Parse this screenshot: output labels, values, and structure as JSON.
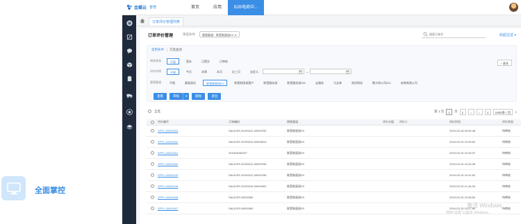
{
  "promo": {
    "label": "全面掌控",
    "icon": "monitor-icon"
  },
  "topbar": {
    "logo_text": "金蝶云",
    "logo_sub": "苍穹",
    "nav": [
      "首页",
      "应用",
      "B2B电商中..."
    ]
  },
  "tabs": {
    "active": "订单评价管理列表"
  },
  "panel": {
    "title": "订单评价管理",
    "filter_label": "筛选条件",
    "filter_chip": "管理渠道：联宽制画鼠EX ✕",
    "search_placeholder": "搜索订单号",
    "collapse_label": "收起过滤 ▾"
  },
  "schema": {
    "label": "常用条件",
    "separator": "|",
    "name": "方案查询"
  },
  "filters": {
    "status": {
      "label": "审核状态",
      "options": [
        "不限",
        "暂存",
        "已提交",
        "已审核"
      ],
      "selected": 0
    },
    "eval_date": {
      "label": "评价时间",
      "options": [
        "不限",
        "今天",
        "本周",
        "本月",
        "近三月",
        "自定义"
      ],
      "selected": 0,
      "date_separator": "—"
    },
    "channel": {
      "label": "管理渠道",
      "options": [
        "不限",
        "渠道测试",
        "联宽制画鼠EX",
        "联宽制画鼠客户",
        "联宽服务部",
        "联宽服务部002",
        "云服务",
        "马丛林",
        "测试网站",
        "数大地公司002",
        "安装商测公司"
      ],
      "selected": 2
    },
    "more_label": "+ 更多"
  },
  "buttons": {
    "query": "查看",
    "audit": "审核",
    "audit_caret": "▾",
    "delete": "删除",
    "exit": "退出"
  },
  "listbar": {
    "select_all": "全选",
    "page_prefix": "第 1 页",
    "page_current": "1",
    "page_suffix": "页",
    "page_size": "1000条 / 页"
  },
  "table": {
    "columns": [
      "评价编号",
      "订单编码",
      "销售渠道",
      "评价分值",
      "评价人",
      "评价时间",
      "评价状态"
    ],
    "rows": [
      [
        "SPPL-00000203",
        "SALEOR-20190312-00000789",
        "联宽制画鼠EX",
        "",
        "",
        "2019-03-18 09:34:48",
        "待审核"
      ],
      [
        "SPPL-00000202",
        "SALEOR-20190313-00000813",
        "联宽制画鼠EX",
        "",
        "",
        "2019-03-15 10:39:52",
        "待审核"
      ],
      [
        "SPPL-00000201",
        "201903081057",
        "联宽制画鼠EX",
        "",
        "",
        "2019-03-15 10:36:37",
        "待审核"
      ],
      [
        "SPPL-00000200",
        "SALEOR-20190312-00000785",
        "联宽制画鼠EX",
        "",
        "",
        "2019-03-15 10:34:36",
        "待审核"
      ],
      [
        "SPPL-00000199",
        "SALEOR-20190312-00000785",
        "联宽制画鼠EX",
        "",
        "",
        "2019-03-15 10:31:52",
        "待审核"
      ],
      [
        "SPPL-00000198",
        "SALEOR-20190315-00000902",
        "联宽制画鼠EX",
        "",
        "",
        "2019-03-15 11:44:36",
        "待审核"
      ],
      [
        "SPPL-00000188",
        "SALEOR-00000360",
        "联宽制画鼠EX",
        "",
        "",
        "2019-03-15 10:38:52",
        "待审核"
      ],
      [
        "SPPL-00000187",
        "SALEOR-00000360",
        "联宽制画鼠EX",
        "",
        "",
        "2019-03-15 10:27:50",
        "待审核"
      ]
    ]
  },
  "watermark": {
    "title": "激活 Windows",
    "sub": "转到\"设置\"以激活 Windows。"
  },
  "colors": {
    "accent": "#3a8ee6",
    "sidebar": "#1f2a3c",
    "promo_box": "#cfe6fb"
  }
}
